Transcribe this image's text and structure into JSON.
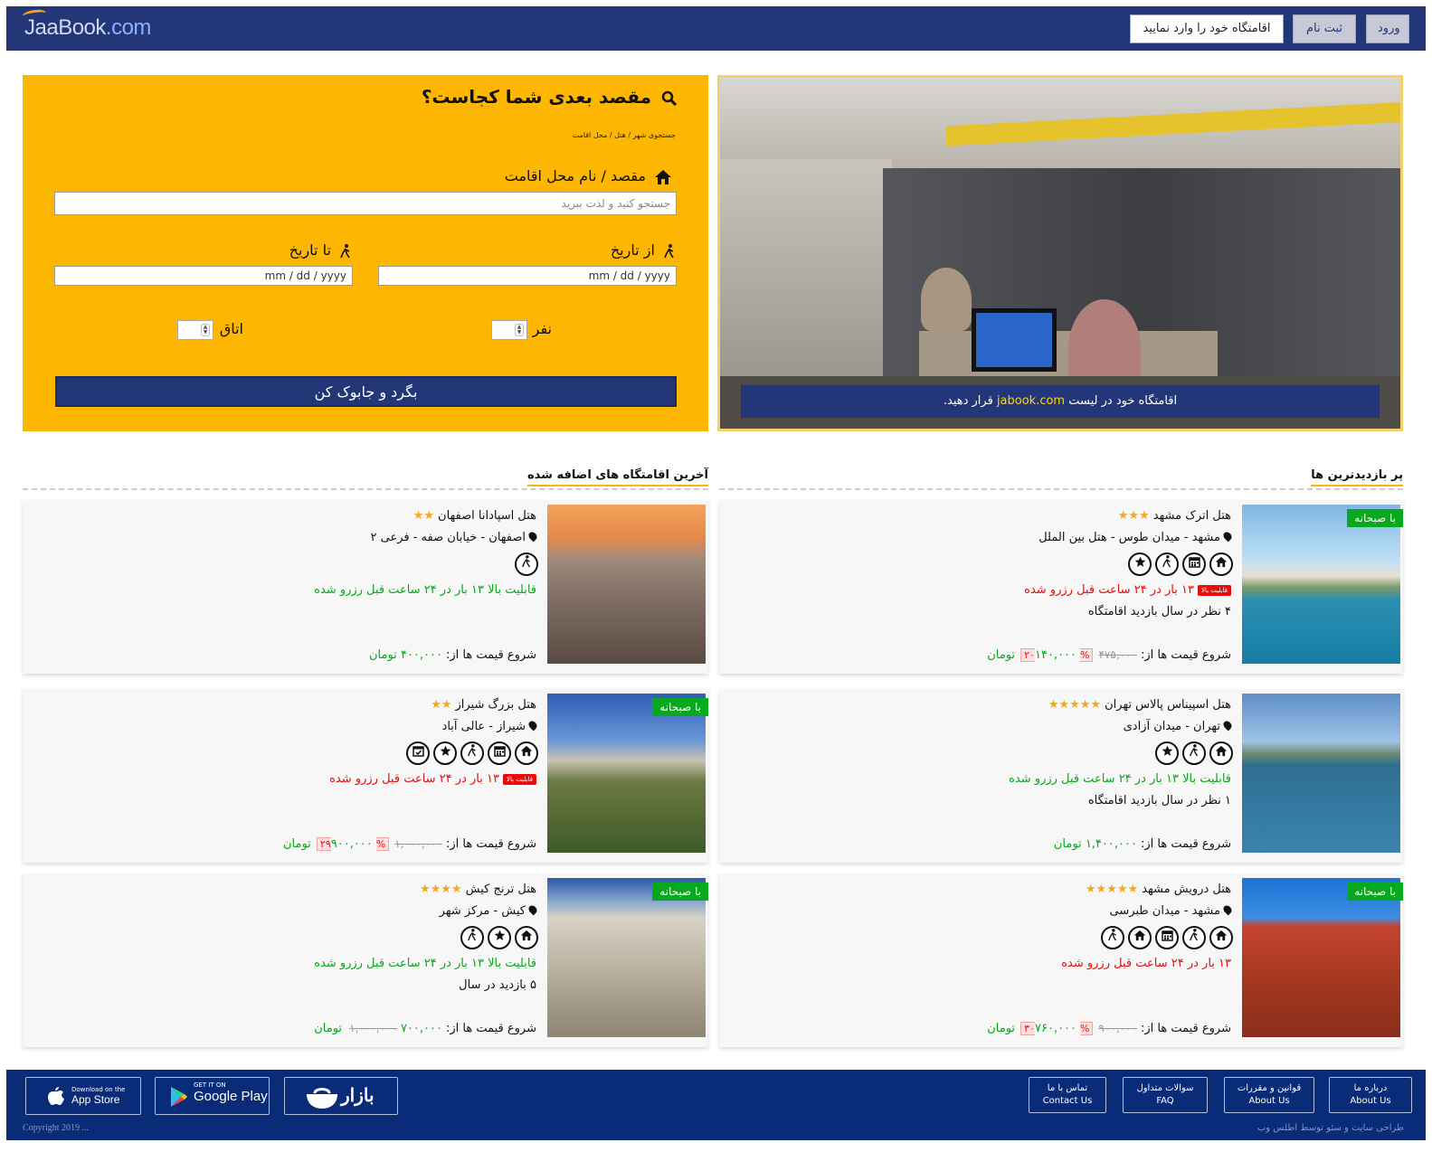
{
  "header": {
    "logo_main": "JaaBook",
    "logo_suffix": ".com",
    "login": "ورود",
    "signup": "ثبت نام",
    "submit_hotel": "اقامتگاه خود را وارد نمایید"
  },
  "search": {
    "title": "مقصد بعدی شما کجاست؟",
    "subtitle": "جستجوی شهر / هتل / محل اقامت",
    "destination_label": "مقصد / نام محل اقامت",
    "destination_placeholder": "جستجو کنید و لذت ببرید",
    "from_label": "از تاریخ",
    "to_label": "تا تاریخ",
    "date_placeholder": "mm / dd / yyyy",
    "persons_label": "نفر",
    "rooms_label": "اتاق",
    "button": "بگرد و جابوک کن"
  },
  "hero": {
    "banner_pre": "اقامتگاه خود در لیست",
    "banner_highlight": "jabook.com",
    "banner_post": "قرار دهید."
  },
  "sections": {
    "popular": "پر بازدیدترین ها",
    "latest": "آخرین اقامتگاه های اضافه شده"
  },
  "labels": {
    "breakfast": "با صبحانه",
    "price_prefix": "شروع قیمت ها از:",
    "currency": "تومان",
    "high_tag": "قابلیت بالا"
  },
  "popular_hotels": [
    {
      "name": "هتل اترک مشهد",
      "stars": "★★★",
      "address": "مشهد - میدان طوس - هتل بین الملل",
      "features": [
        "home-icon",
        "calendar-icon",
        "walker-icon",
        "star-icon"
      ],
      "breakfast": true,
      "availability": "۱۳ بار در ۲۴ ساعت قبل رزرو شده",
      "availability_color": "red",
      "high_tag": true,
      "extra": "۴ نظر در سال بازدید اقامتگاه",
      "old_price": "۴۷۵,۰۰۰",
      "discount": "%۲۰",
      "price": "۱۴۰,۰۰۰"
    },
    {
      "name": "هتل اسپیناس پالاس تهران",
      "stars": "★★★★★",
      "address": "تهران - میدان آزادی",
      "features": [
        "home-icon",
        "walker-icon",
        "star-icon"
      ],
      "breakfast": false,
      "availability": "قابلیت بالا ۱۳ بار در ۲۴ ساعت قبل رزرو شده",
      "availability_color": "green",
      "high_tag": false,
      "extra": "۱ نظر در سال بازدید اقامتگاه",
      "old_price": "",
      "discount": "",
      "price": "۱,۴۰۰,۰۰۰"
    },
    {
      "name": "هتل درویش مشهد",
      "stars": "★★★★★",
      "address": "مشهد - میدان طبرسی",
      "features": [
        "home-icon",
        "walker-icon",
        "calendar-icon",
        "home-icon",
        "walker-icon"
      ],
      "breakfast": true,
      "availability": "۱۳ بار در ۲۴ ساعت قبل رزرو شده",
      "availability_color": "red",
      "high_tag": false,
      "extra": "",
      "old_price": "۹۰۰,۰۰۰",
      "discount": "%۳۰",
      "price": "۷۶۰,۰۰۰"
    }
  ],
  "latest_hotels": [
    {
      "name": "هتل اسپادانا اصفهان",
      "stars": "★★",
      "address": "اصفهان - خیابان صفه - فرعی ۲",
      "features": [
        "walker-icon"
      ],
      "breakfast": false,
      "availability": "قابلیت بالا ۱۳ بار در ۲۴ ساعت قبل رزرو شده",
      "availability_color": "green",
      "high_tag": false,
      "extra": "",
      "old_price": "",
      "discount": "",
      "price": "۴۰۰,۰۰۰"
    },
    {
      "name": "هتل بزرگ شیراز",
      "stars": "★★",
      "address": "شیراز - عالی آباد",
      "features": [
        "home-icon",
        "calendar-icon",
        "walker-icon",
        "star-icon",
        "calendar-check-icon"
      ],
      "breakfast": true,
      "availability": "۱۳ بار در ۲۴ ساعت قبل رزرو شده",
      "availability_color": "red",
      "high_tag": true,
      "extra": "",
      "old_price": "۱,۰۰۰,۰۰۰",
      "discount": "%۲۹",
      "price": "۹۰۰,۰۰۰"
    },
    {
      "name": "هتل ترنج کیش",
      "stars": "★★★★",
      "address": "کیش - مرکز شهر",
      "features": [
        "home-icon",
        "star-icon",
        "walker-icon"
      ],
      "breakfast": true,
      "availability": "قابلیت بالا ۱۳ بار در ۲۴ ساعت قبل رزرو شده",
      "availability_color": "green",
      "high_tag": false,
      "extra": "۵ بازدید در سال",
      "old_price": "۱,۰۰۰,۰۰۰",
      "discount": "",
      "price": "۷۰۰,۰۰۰"
    }
  ],
  "footer": {
    "links": [
      {
        "fa": "درباره ما",
        "en": "About Us"
      },
      {
        "fa": "قوانین و مقررات",
        "en": "About Us"
      },
      {
        "fa": "سوالات متداول",
        "en": "FAQ"
      },
      {
        "fa": "تماس با ما",
        "en": "Contact Us"
      }
    ],
    "appstore_small": "Download on the",
    "appstore_big": "App Store",
    "gplay_small": "GET IT ON",
    "gplay_big": "Google Play",
    "bazaar": "بازار",
    "copyright_left": "Copyright 2019 ...",
    "copyright_right": "طراحی سایت و سئو توسط اطلس وب"
  }
}
